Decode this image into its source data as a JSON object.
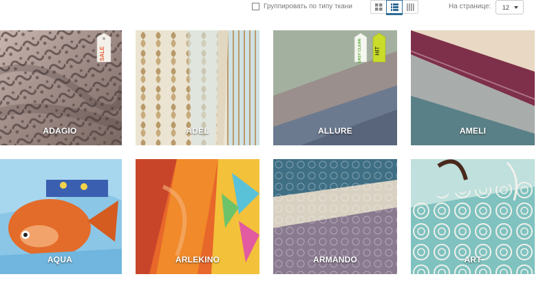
{
  "toolbar": {
    "group_label": "Группировать по типу ткани",
    "per_page_label": "На странице:",
    "per_page_value": "12",
    "views": [
      "grid-small-icon",
      "grid-large-icon",
      "list-columns-icon"
    ],
    "active_view": 1
  },
  "products": [
    {
      "name": "ADAGIO",
      "badges": [
        "SALE"
      ]
    },
    {
      "name": "ADEL",
      "badges": []
    },
    {
      "name": "ALLURE",
      "badges": [
        "EASY CLEAN",
        "HIT"
      ]
    },
    {
      "name": "AMELI",
      "badges": []
    },
    {
      "name": "AQUA",
      "badges": []
    },
    {
      "name": "ARLEKINO",
      "badges": []
    },
    {
      "name": "ARMANDO",
      "badges": []
    },
    {
      "name": "ART",
      "badges": []
    }
  ],
  "colors": {
    "accent": "#2d6b97",
    "sale_tag": "#e8643c",
    "easy_clean_tag": "#5aa73a",
    "hit_tag": "#c9dc2a"
  }
}
